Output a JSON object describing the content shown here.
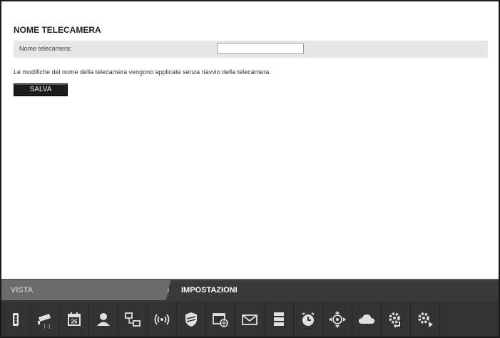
{
  "settings": {
    "title": "NOME TELECAMERA",
    "field_label": "Nome telecamera:",
    "field_value": "",
    "note": "Le modifiche del nome della telecamera vengono applicate senza riavvio della telecamera.",
    "save_label": "SALVA"
  },
  "tabs": {
    "vista": "VISTA",
    "impostazioni": "IMPOSTAZIONI",
    "active": "IMPOSTAZIONI"
  },
  "toolbar": {
    "icons": [
      "status-light-icon",
      "camera-icon",
      "calendar-icon",
      "user-icon",
      "network-icon",
      "wireless-icon",
      "security-shield-icon",
      "web-window-icon",
      "mail-icon",
      "server-icon",
      "clock-icon",
      "ptz-icon",
      "cloud-icon",
      "settings-return-icon",
      "settings-next-icon"
    ],
    "calendar_day": "26",
    "camera_badge": "[...]"
  },
  "colors": {
    "panel_bg": "#ffffff",
    "row_bg": "#e6e6e6",
    "bar_bg": "#333333",
    "tab_inactive": "#6b6b6b",
    "icon_fg": "#e0e0e0"
  }
}
